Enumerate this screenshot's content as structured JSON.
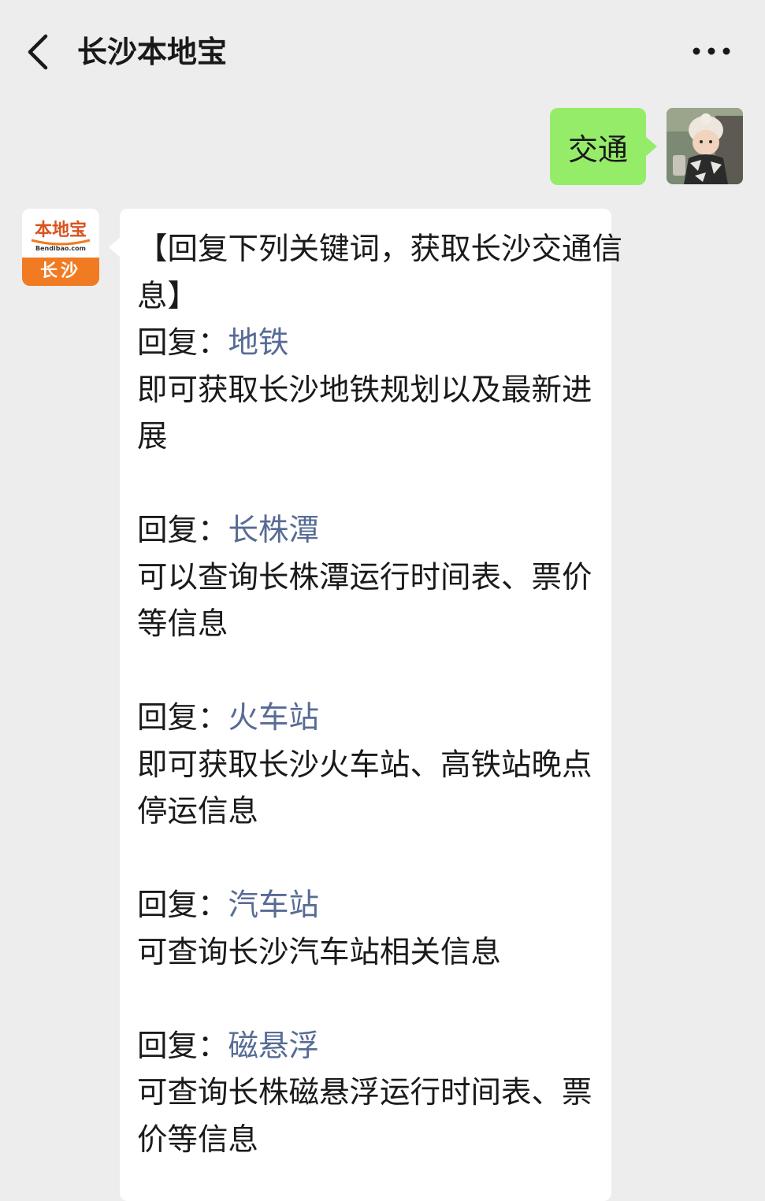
{
  "header": {
    "title": "长沙本地宝",
    "back_icon": "chevron-left-icon",
    "more_icon": "more-dots-icon"
  },
  "chat": {
    "user_message": "交通",
    "bot_avatar": {
      "brand": "本地宝",
      "site": "Bendibao.com",
      "city": "长沙"
    },
    "reply": {
      "intro": [
        "【回复下列关键词，获取长沙交通信",
        "息】"
      ],
      "prefix": "回复：",
      "items": [
        {
          "keyword": "地铁",
          "desc": [
            "即可获取长沙地铁规划以及最新进",
            "展"
          ]
        },
        {
          "keyword": "长株潭",
          "desc": [
            "可以查询长株潭运行时间表、票价",
            "等信息"
          ]
        },
        {
          "keyword": "火车站",
          "desc": [
            "即可获取长沙火车站、高铁站晚点",
            "停运信息"
          ]
        },
        {
          "keyword": "汽车站",
          "desc": [
            "可查询长沙汽车站相关信息"
          ]
        },
        {
          "keyword": "磁悬浮",
          "desc": [
            "可查询长株磁悬浮运行时间表、票",
            "价等信息"
          ]
        }
      ]
    }
  },
  "colors": {
    "background": "#ededed",
    "user_bubble": "#95ec69",
    "bot_bubble": "#ffffff",
    "keyword_link": "#576b95",
    "brand_orange": "#f07b22"
  }
}
